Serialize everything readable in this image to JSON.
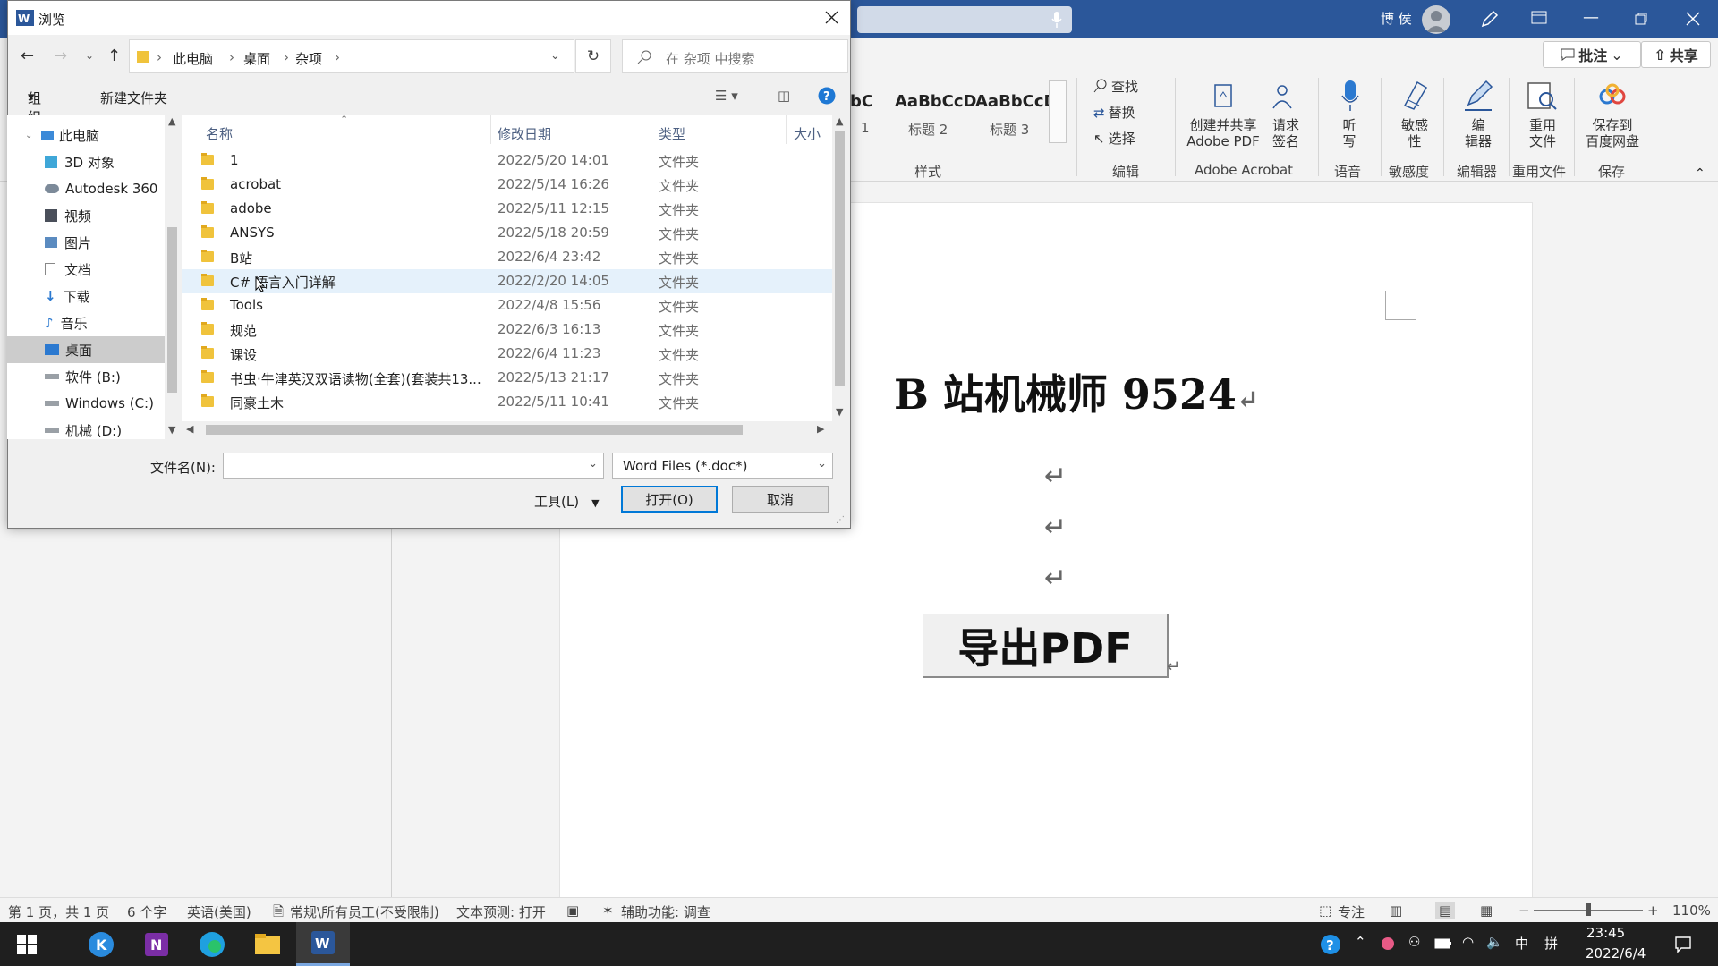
{
  "word": {
    "user": "博 侯",
    "share_comments": "批注",
    "share": "共享",
    "styles": [
      {
        "sample": "AaBbCcD",
        "name": "标题 2"
      },
      {
        "sample": "AaBbCcD",
        "name": "标题 3"
      }
    ],
    "style_partial_sample": "bC",
    "style_partial_name": "1",
    "ribbon": {
      "find": "查找",
      "replace": "替换",
      "select": "选择",
      "group_styles": "样式",
      "group_edit": "编辑",
      "create_share_pdf": [
        "创建并共享",
        "Adobe PDF"
      ],
      "request_sign": [
        "请求",
        "签名"
      ],
      "group_acrobat": "Adobe Acrobat",
      "dictate": [
        "听",
        "写"
      ],
      "group_voice": "语音",
      "sensitivity": [
        "敏感",
        "性"
      ],
      "group_sensitivity": "敏感度",
      "editor": [
        "编",
        "辑器"
      ],
      "group_editor": "编辑器",
      "reuse": [
        "重用",
        "文件"
      ],
      "group_reuse": "重用文件",
      "save_baidu": [
        "保存到",
        "百度网盘"
      ],
      "group_save": "保存"
    },
    "doc": {
      "title": "B 站机械师 9524",
      "para_mark": "↵",
      "button": "导出PDF"
    },
    "status": {
      "page": "第 1 页，共 1 页",
      "words": "6 个字",
      "lang": "英语(美国)",
      "policy": "常规\\所有员工(不受限制)",
      "prediction": "文本预测: 打开",
      "accessibility": "辅助功能: 调查",
      "focus": "专注",
      "zoom": "110%"
    }
  },
  "dialog": {
    "title": "浏览",
    "breadcrumb": [
      "此电脑",
      "桌面",
      "杂项"
    ],
    "search_placeholder": "在 杂项 中搜索",
    "organize": "组织",
    "new_folder": "新建文件夹",
    "nav": [
      {
        "label": "此电脑",
        "icon": "pc-icon"
      },
      {
        "label": "3D 对象",
        "icon": "cube-icon"
      },
      {
        "label": "Autodesk 360",
        "icon": "cloud-icon"
      },
      {
        "label": "视频",
        "icon": "video-icon"
      },
      {
        "label": "图片",
        "icon": "picture-icon"
      },
      {
        "label": "文档",
        "icon": "document-icon"
      },
      {
        "label": "下载",
        "icon": "download-icon"
      },
      {
        "label": "音乐",
        "icon": "music-icon"
      },
      {
        "label": "桌面",
        "icon": "desktop-icon"
      },
      {
        "label": "软件 (B:)",
        "icon": "drive-icon"
      },
      {
        "label": "Windows (C:)",
        "icon": "drive-icon"
      },
      {
        "label": "机械 (D:)",
        "icon": "drive-icon"
      }
    ],
    "columns": {
      "name": "名称",
      "modified": "修改日期",
      "type": "类型",
      "size": "大小"
    },
    "rows": [
      {
        "name": "1",
        "date": "2022/5/20 14:01",
        "type": "文件夹"
      },
      {
        "name": "acrobat",
        "date": "2022/5/14 16:26",
        "type": "文件夹"
      },
      {
        "name": "adobe",
        "date": "2022/5/11 12:15",
        "type": "文件夹"
      },
      {
        "name": "ANSYS",
        "date": "2022/5/18 20:59",
        "type": "文件夹"
      },
      {
        "name": "B站",
        "date": "2022/6/4 23:42",
        "type": "文件夹"
      },
      {
        "name": "C# 语言入门详解",
        "date": "2022/2/20 14:05",
        "type": "文件夹"
      },
      {
        "name": "Tools",
        "date": "2022/4/8 15:56",
        "type": "文件夹"
      },
      {
        "name": "规范",
        "date": "2022/6/3 16:13",
        "type": "文件夹"
      },
      {
        "name": "课设",
        "date": "2022/6/4 11:23",
        "type": "文件夹"
      },
      {
        "name": "书虫·牛津英汉双语读物(全套)(套装共13...",
        "date": "2022/5/13 21:17",
        "type": "文件夹"
      },
      {
        "name": "同豪土木",
        "date": "2022/5/11 10:41",
        "type": "文件夹"
      }
    ],
    "filename_label": "文件名(N):",
    "filename_value": "",
    "filetype": "Word Files (*.doc*)",
    "tools": "工具(L)",
    "open": "打开(O)",
    "cancel": "取消"
  },
  "taskbar": {
    "time": "23:45",
    "date": "2022/6/4",
    "ime": "中",
    "ime2": "拼"
  }
}
